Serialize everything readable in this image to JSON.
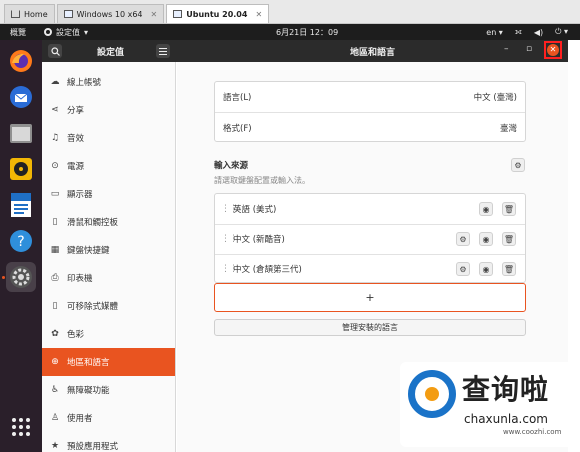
{
  "vm_tabs": [
    {
      "label": "Home"
    },
    {
      "label": "Windows 10 x64"
    },
    {
      "label": "Ubuntu 20.04"
    }
  ],
  "topbar": {
    "activities": "概覽",
    "app_menu": "設定值",
    "clock": "6月21日 12：09",
    "lang": "en"
  },
  "dock": {
    "icons": [
      "firefox-icon",
      "thunderbird-icon",
      "files-icon",
      "rhythmbox-icon",
      "writer-icon",
      "help-icon",
      "settings-icon",
      "app-grid-icon"
    ]
  },
  "header": {
    "sidebar_title": "設定值",
    "main_title": "地區和語言"
  },
  "sidebar": {
    "items": [
      {
        "label": "線上帳號",
        "icon": "cloud-icon",
        "glyph": "☁"
      },
      {
        "label": "分享",
        "icon": "share-icon",
        "glyph": "⋖"
      },
      {
        "label": "音效",
        "icon": "music-icon",
        "glyph": "♫"
      },
      {
        "label": "電源",
        "icon": "power-icon",
        "glyph": "⊙"
      },
      {
        "label": "顯示器",
        "icon": "display-icon",
        "glyph": "▭"
      },
      {
        "label": "滑鼠和觸控板",
        "icon": "mouse-icon",
        "glyph": "▯"
      },
      {
        "label": "鍵盤快捷鍵",
        "icon": "keyboard-icon",
        "glyph": "▦"
      },
      {
        "label": "印表機",
        "icon": "printer-icon",
        "glyph": "⎙"
      },
      {
        "label": "可移除式媒體",
        "icon": "media-icon",
        "glyph": "▯"
      },
      {
        "label": "色彩",
        "icon": "color-icon",
        "glyph": "✿"
      },
      {
        "label": "地區和語言",
        "icon": "globe-icon",
        "glyph": "⊕",
        "active": true
      },
      {
        "label": "無障礙功能",
        "icon": "accessibility-icon",
        "glyph": "♿"
      },
      {
        "label": "使用者",
        "icon": "user-icon",
        "glyph": "♙"
      },
      {
        "label": "預設應用程式",
        "icon": "star-icon",
        "glyph": "★"
      }
    ]
  },
  "region": {
    "language_label": "語言(L)",
    "language_value": "中文 (臺灣)",
    "formats_label": "格式(F)",
    "formats_value": "臺灣"
  },
  "input_sources": {
    "title": "輸入來源",
    "subtitle": "請選取鍵盤配置或輸入法。",
    "items": [
      {
        "label": "英語 (美式)",
        "has_settings": false
      },
      {
        "label": "中文 (新酷音)",
        "has_settings": true
      },
      {
        "label": "中文 (倉頡第三代)",
        "has_settings": true
      }
    ],
    "add_label": "+",
    "manage_label": "管理安裝的語言"
  },
  "watermark": {
    "big": "查询啦",
    "en": "chaxunla.com",
    "url": "www.coozhi.com"
  },
  "colors": {
    "accent": "#e95420",
    "dock_bg": "#2a1f2a",
    "header_bg": "#2b2b2b"
  }
}
